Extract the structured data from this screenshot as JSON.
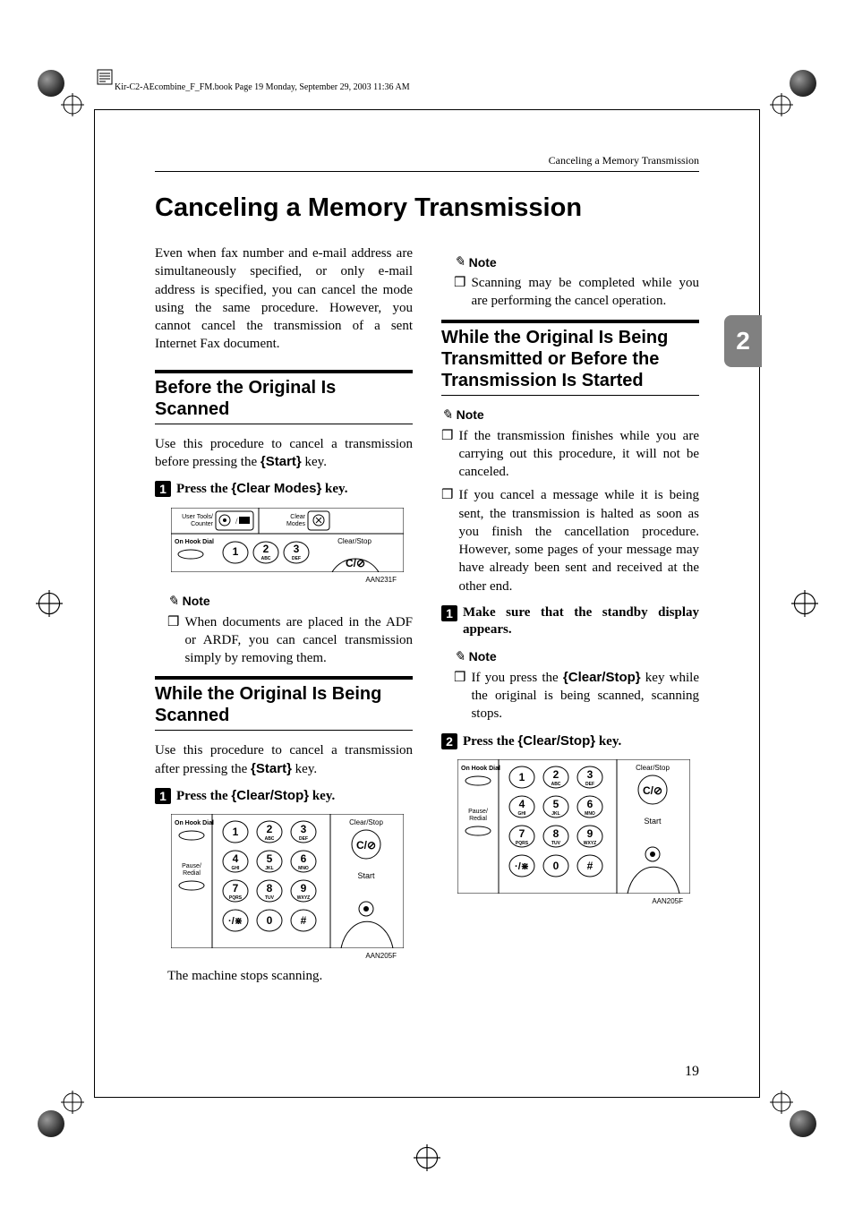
{
  "meta": {
    "header_line": "Kir-C2-AEcombine_F_FM.book  Page 19  Monday, September 29, 2003  11:36 AM"
  },
  "running_head": "Canceling a Memory Transmission",
  "title": "Canceling a Memory Transmission",
  "chapter_tab": "2",
  "page_number": "19",
  "left": {
    "intro": "Even when fax number and e-mail address are simultaneously specified, or only e-mail address is specified, you can cancel the mode using the same procedure. However, you cannot cancel the transmission of a sent Internet Fax document.",
    "section1": {
      "heading": "Before the Original Is Scanned",
      "body": "Use this procedure to cancel a transmission before pressing the ",
      "body_key": "Start",
      "body_suffix": " key.",
      "step1_num": "1",
      "step1_pre": "Press the ",
      "step1_key": "Clear Modes",
      "step1_post": " key.",
      "fig1_code": "AAN231F",
      "note_label": "Note",
      "note1": "When documents are placed in the ADF or ARDF, you can cancel transmission simply by removing them."
    },
    "section2": {
      "heading": "While the Original Is Being Scanned",
      "body_pre": "Use this procedure to cancel a transmission after pressing the ",
      "body_key": "Start",
      "body_post": " key.",
      "step1_num": "1",
      "step1_pre": "Press the ",
      "step1_key": "Clear/Stop",
      "step1_post": " key.",
      "fig_code": "AAN205F",
      "closing": "The machine stops scanning."
    }
  },
  "right": {
    "note_top_label": "Note",
    "note_top": "Scanning may be completed while you are performing the cancel operation.",
    "section3": {
      "heading": "While the Original Is Being Transmitted or Before the Transmission Is Started",
      "note_label": "Note",
      "note1": "If the transmission finishes while you are carrying out this procedure, it will not be canceled.",
      "note2": "If you cancel a message while it is being sent, the transmission is halted as soon as you finish the cancellation procedure. However, some pages of your message may have already been sent and received at the other end.",
      "step1_num": "1",
      "step1_text": "Make sure that the standby display appears.",
      "step1_note_label": "Note",
      "step1_note_pre": "If you press the ",
      "step1_note_key": "Clear/Stop",
      "step1_note_post": " key while the original is being scanned, scanning stops.",
      "step2_num": "2",
      "step2_pre": "Press the ",
      "step2_key": "Clear/Stop",
      "step2_post": " key.",
      "fig_code": "AAN205F"
    }
  },
  "panel1": {
    "user_tools": "User Tools/\nCounter",
    "clear_modes": "Clear\nModes",
    "on_hook": "On Hook Dial",
    "clear_stop": "Clear/Stop",
    "k1": "1",
    "k2": "2",
    "k2s": "ABC",
    "k3": "3",
    "k3s": "DEF"
  },
  "keypad": {
    "on_hook": "On Hook Dial",
    "pause": "Pause/\nRedial",
    "clear_stop": "Clear/Stop",
    "start": "Start",
    "k1": "1",
    "k2": "2",
    "k2s": "ABC",
    "k3": "3",
    "k3s": "DEF",
    "k4": "4",
    "k4s": "GHI",
    "k5": "5",
    "k5s": "JKL",
    "k6": "6",
    "k6s": "MNO",
    "k7": "7",
    "k7s": "PQRS",
    "k8": "8",
    "k8s": "TUV",
    "k9": "9",
    "k9s": "WXYZ",
    "k0": "0",
    "kstar": "·/⋇",
    "khash": "#"
  }
}
